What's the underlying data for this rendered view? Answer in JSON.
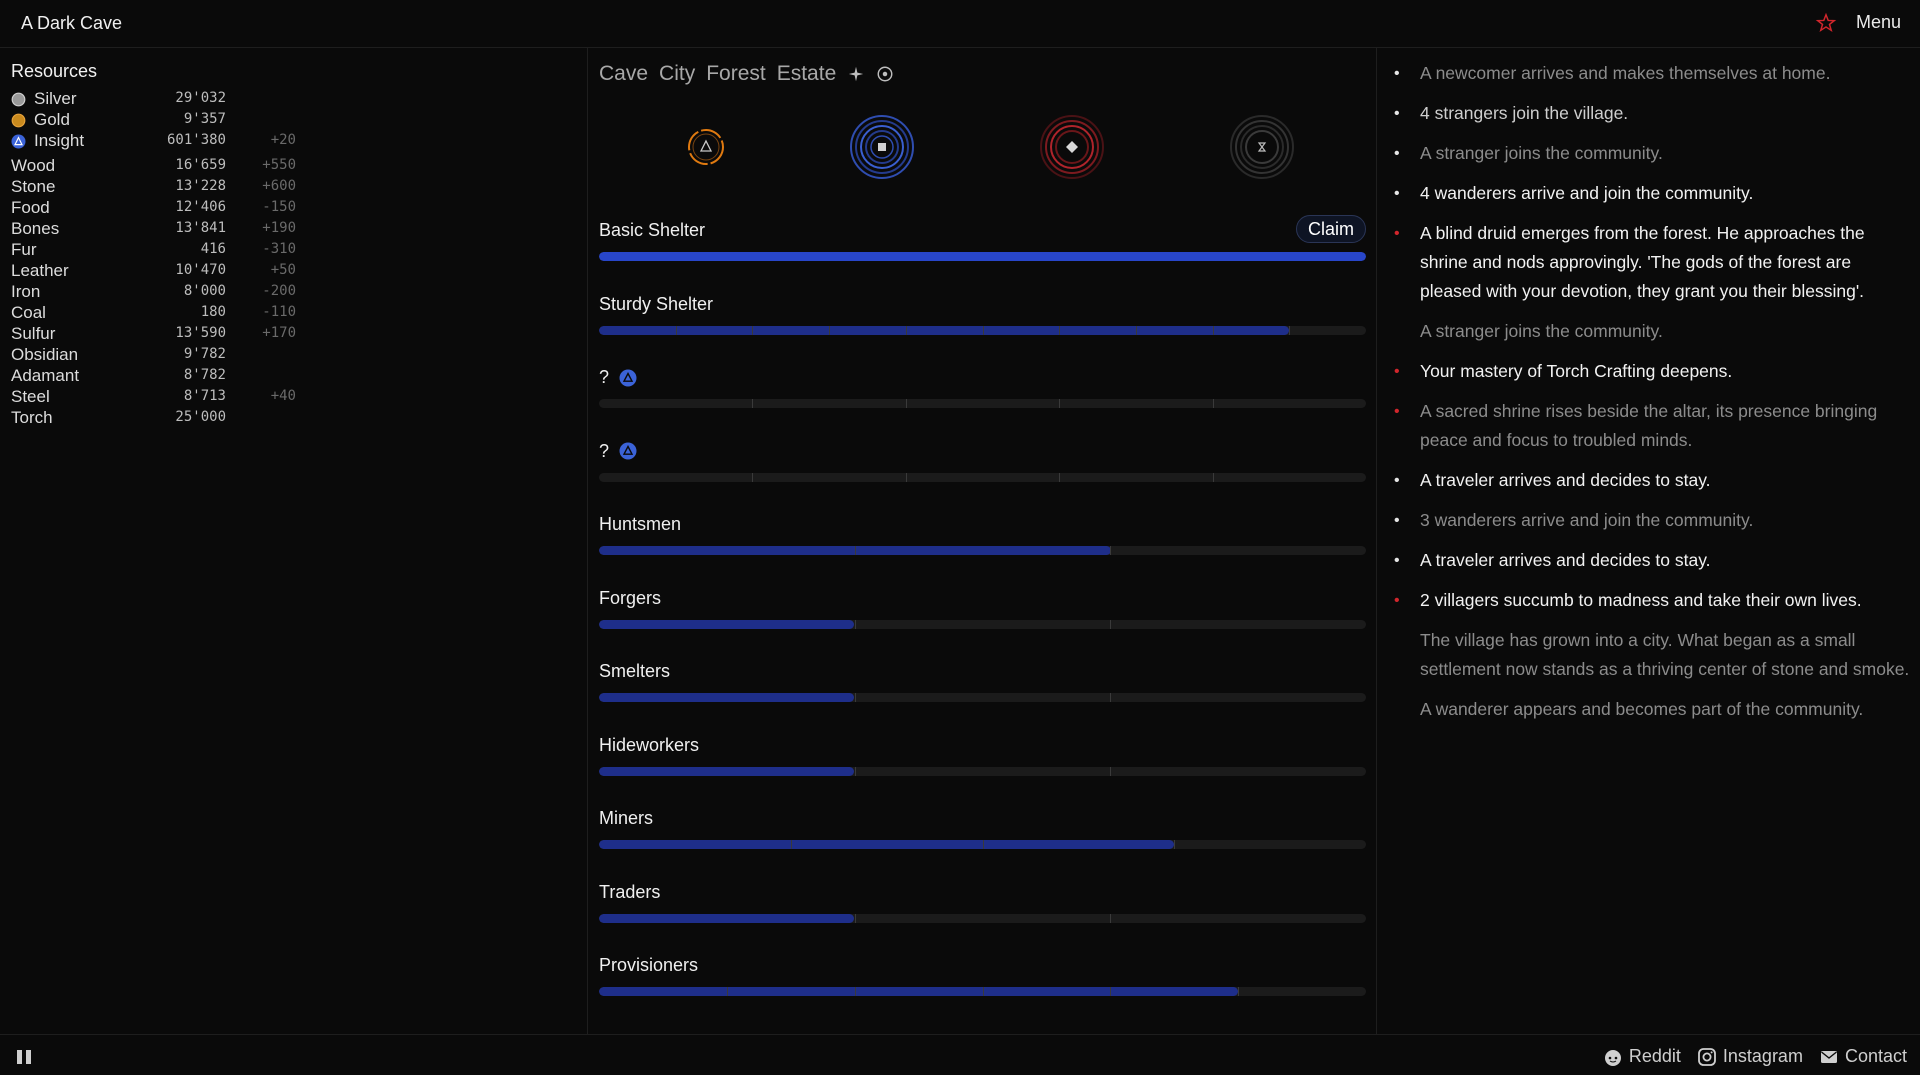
{
  "app": {
    "title": "A Dark Cave",
    "menu_label": "Menu"
  },
  "resources": {
    "title": "Resources",
    "items": [
      {
        "name": "Silver",
        "amount": "29'032",
        "rate": "",
        "icon": "silver-coin-icon",
        "color": "#9a9a9a"
      },
      {
        "name": "Gold",
        "amount": "9'357",
        "rate": "",
        "icon": "gold-coin-icon",
        "color": "#c98a1e"
      },
      {
        "name": "Insight",
        "amount": "601'380",
        "rate": "+20",
        "icon": "insight-triangle-icon",
        "color": "#3b63d8"
      },
      {
        "name": "Wood",
        "amount": "16'659",
        "rate": "+550"
      },
      {
        "name": "Stone",
        "amount": "13'228",
        "rate": "+600"
      },
      {
        "name": "Food",
        "amount": "12'406",
        "rate": "-150"
      },
      {
        "name": "Bones",
        "amount": "13'841",
        "rate": "+190"
      },
      {
        "name": "Fur",
        "amount": "416",
        "rate": "-310"
      },
      {
        "name": "Leather",
        "amount": "10'470",
        "rate": "+50"
      },
      {
        "name": "Iron",
        "amount": "8'000",
        "rate": "-200"
      },
      {
        "name": "Coal",
        "amount": "180",
        "rate": "-110"
      },
      {
        "name": "Sulfur",
        "amount": "13'590",
        "rate": "+170"
      },
      {
        "name": "Obsidian",
        "amount": "9'782",
        "rate": ""
      },
      {
        "name": "Adamant",
        "amount": "8'782",
        "rate": ""
      },
      {
        "name": "Steel",
        "amount": "8'713",
        "rate": "+40"
      },
      {
        "name": "Torch",
        "amount": "25'000",
        "rate": ""
      }
    ]
  },
  "tabs": [
    "Cave",
    "City",
    "Forest",
    "Estate"
  ],
  "tab_icons": [
    "compass-star-icon",
    "circle-target-icon"
  ],
  "rings": [
    {
      "icon": "triangle-ring-icon",
      "color": "#e07a10"
    },
    {
      "icon": "square-ring-icon",
      "color": "#3a5fd0"
    },
    {
      "icon": "diamond-ring-icon",
      "color": "#b0242b"
    },
    {
      "icon": "hourglass-ring-icon",
      "color": "#555555"
    }
  ],
  "jobs": [
    {
      "label": "Basic Shelter",
      "progress": 1.0,
      "segments": 1,
      "claim": "Claim"
    },
    {
      "label": "Sturdy Shelter",
      "progress": 0.9,
      "segments": 10
    },
    {
      "label": "?",
      "unknown": true,
      "progress": 0,
      "segments": 5
    },
    {
      "label": "?",
      "unknown": true,
      "progress": 0,
      "segments": 5
    },
    {
      "label": "Huntsmen",
      "progress": 0.667,
      "segments": 3
    },
    {
      "label": "Forgers",
      "progress": 0.333,
      "segments": 3
    },
    {
      "label": "Smelters",
      "progress": 0.333,
      "segments": 3
    },
    {
      "label": "Hideworkers",
      "progress": 0.333,
      "segments": 3
    },
    {
      "label": "Miners",
      "progress": 0.75,
      "segments": 4
    },
    {
      "label": "Traders",
      "progress": 0.333,
      "segments": 3
    },
    {
      "label": "Provisioners",
      "progress": 0.833,
      "segments": 6
    }
  ],
  "log": [
    {
      "text": "A newcomer arrives and makes themselves at home.",
      "bullet": "white",
      "tone": "dim"
    },
    {
      "text": "4 strangers join the village.",
      "bullet": "white",
      "tone": "mid"
    },
    {
      "text": "A stranger joins the community.",
      "bullet": "white",
      "tone": "dim"
    },
    {
      "text": "4 wanderers arrive and join the community.",
      "bullet": "white",
      "tone": "bright"
    },
    {
      "text": "A blind druid emerges from the forest. He approaches the shrine and nods approvingly. 'The gods of the forest are pleased with your devotion, they grant you their blessing'.",
      "bullet": "red",
      "tone": "bright"
    },
    {
      "text": "A stranger joins the community.",
      "bullet": "none",
      "tone": "dim"
    },
    {
      "text": "Your mastery of Torch Crafting deepens.",
      "bullet": "red",
      "tone": "bright"
    },
    {
      "text": "A sacred shrine rises beside the altar, its presence bringing peace and focus to troubled minds.",
      "bullet": "red",
      "tone": "dim"
    },
    {
      "text": "A traveler arrives and decides to stay.",
      "bullet": "white",
      "tone": "bright"
    },
    {
      "text": "3 wanderers arrive and join the community.",
      "bullet": "white",
      "tone": "dim"
    },
    {
      "text": "A traveler arrives and decides to stay.",
      "bullet": "white",
      "tone": "bright"
    },
    {
      "text": "2 villagers succumb to madness and take their own lives.",
      "bullet": "red",
      "tone": "bright"
    },
    {
      "text": "The village has grown into a city. What began as a small settlement now stands as a thriving center of stone and smoke.",
      "bullet": "none",
      "tone": "dim"
    },
    {
      "text": "A wanderer appears and becomes part of the community.",
      "bullet": "none",
      "tone": "dim"
    }
  ],
  "footer": {
    "links": [
      {
        "label": "Reddit",
        "icon": "reddit-icon"
      },
      {
        "label": "Instagram",
        "icon": "instagram-icon"
      },
      {
        "label": "Contact",
        "icon": "mail-icon"
      }
    ]
  },
  "colors": {
    "accent_blue": "#2846c9",
    "bar_fill": "#1e2e8a",
    "bullet_red": "#d2262c",
    "log_bright": "#f2f2f2",
    "log_mid": "#cfcfcf",
    "log_dim": "#8c8c8c"
  }
}
